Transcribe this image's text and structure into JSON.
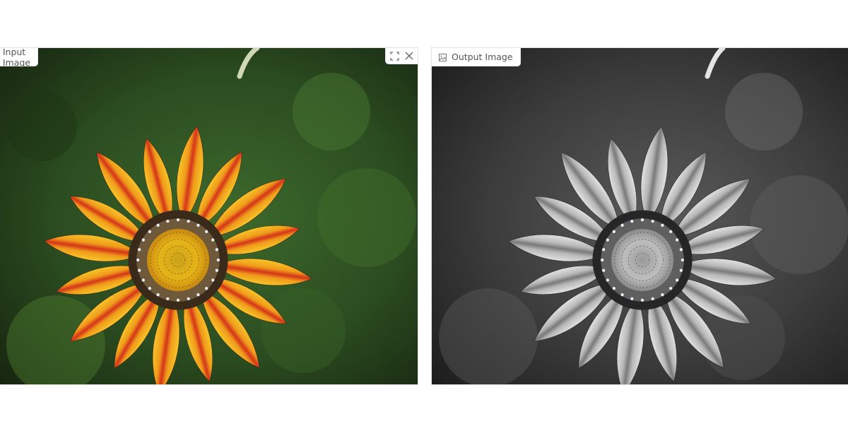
{
  "input_panel": {
    "label": "Input Image",
    "icon": "image-icon",
    "tools": [
      "fullscreen-icon",
      "close-icon"
    ]
  },
  "output_panel": {
    "label": "Output Image",
    "icon": "image-icon"
  },
  "colors": {
    "petal_orange": "#f09a1a",
    "petal_red": "#d4341a",
    "petal_yellow": "#f7c52a",
    "background_green": "#2f5a24",
    "output_gray": "#3a3a3a"
  }
}
